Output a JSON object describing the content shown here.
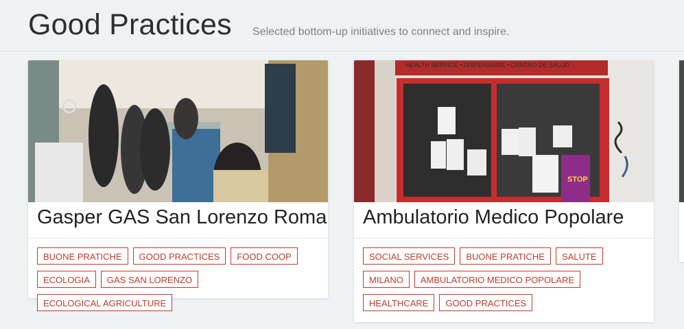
{
  "header": {
    "title": "Good Practices",
    "subtitle": "Selected bottom-up initiatives to connect and inspire."
  },
  "cards": [
    {
      "title": "Gasper GAS San Lorenzo Roma",
      "tags": [
        "BUONE PRATICHE",
        "GOOD PRACTICES",
        "FOOD COOP",
        "ECOLOGIA",
        "GAS SAN LORENZO",
        "ECOLOGICAL AGRICULTURE"
      ]
    },
    {
      "title": "Ambulatorio Medico Popolare",
      "sign_text": "HEALTH SERVICE • DISPENSAIRE • CENTRO DE SALUD",
      "poster_text": "STOP",
      "tags": [
        "SOCIAL SERVICES",
        "BUONE PRATICHE",
        "SALUTE",
        "MILANO",
        "AMBULATORIO MEDICO POPOLARE",
        "HEALTHCARE",
        "GOOD PRACTICES"
      ]
    }
  ],
  "colors": {
    "tag": "#c0392b",
    "background": "#eef2f3"
  }
}
